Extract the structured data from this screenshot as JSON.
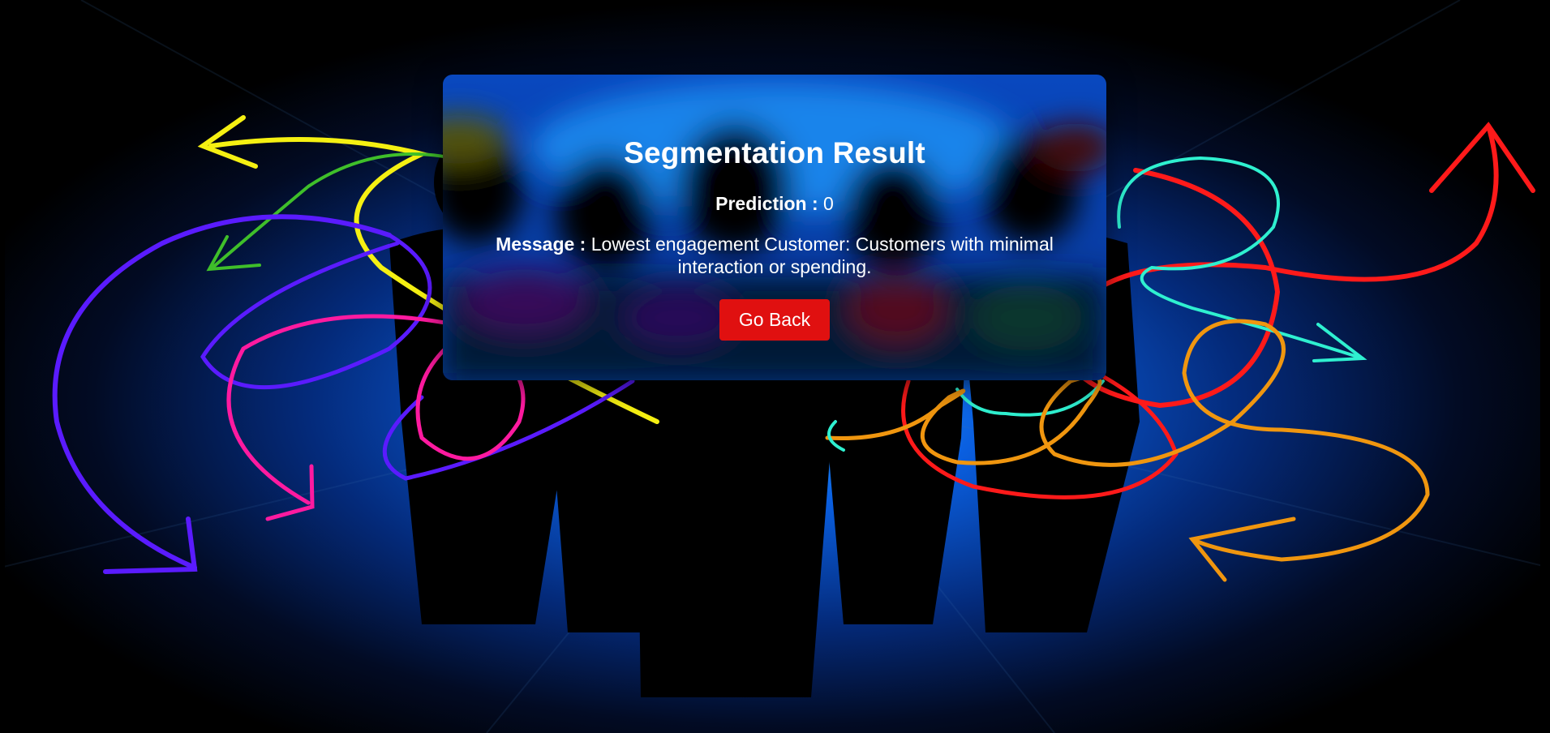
{
  "result": {
    "title": "Segmentation Result",
    "prediction_label": "Prediction :",
    "prediction_value": "0",
    "message_label": "Message :",
    "message_text": "Lowest engagement Customer: Customers with minimal interaction or spending.",
    "back_button": "Go Back"
  },
  "colors": {
    "accent_button": "#e01010",
    "background_glow": "#1a8cff",
    "text": "#ffffff"
  },
  "background": {
    "icon": "people-silhouettes-with-colorful-arrows"
  }
}
